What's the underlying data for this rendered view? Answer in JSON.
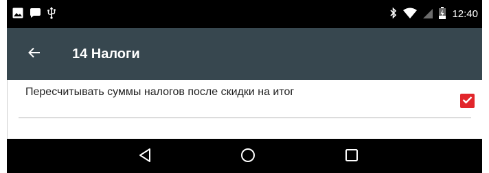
{
  "status_bar": {
    "time": "12:40",
    "left_icons": [
      "image-icon",
      "chat-bubble-icon",
      "usb-icon"
    ],
    "right_icons": [
      "bluetooth-icon",
      "wifi-icon",
      "cell-signal-icon",
      "battery-charging-icon"
    ]
  },
  "toolbar": {
    "back_icon": "arrow-left-icon",
    "title": "14 Налоги",
    "background_color": "#37474f"
  },
  "settings": {
    "items": [
      {
        "label": "Пересчитывать суммы налогов после скидки на итог",
        "checked": true,
        "check_color": "#e2262b"
      }
    ]
  },
  "nav_bar": {
    "buttons": [
      "back-triangle-icon",
      "home-circle-icon",
      "recents-square-icon"
    ]
  }
}
